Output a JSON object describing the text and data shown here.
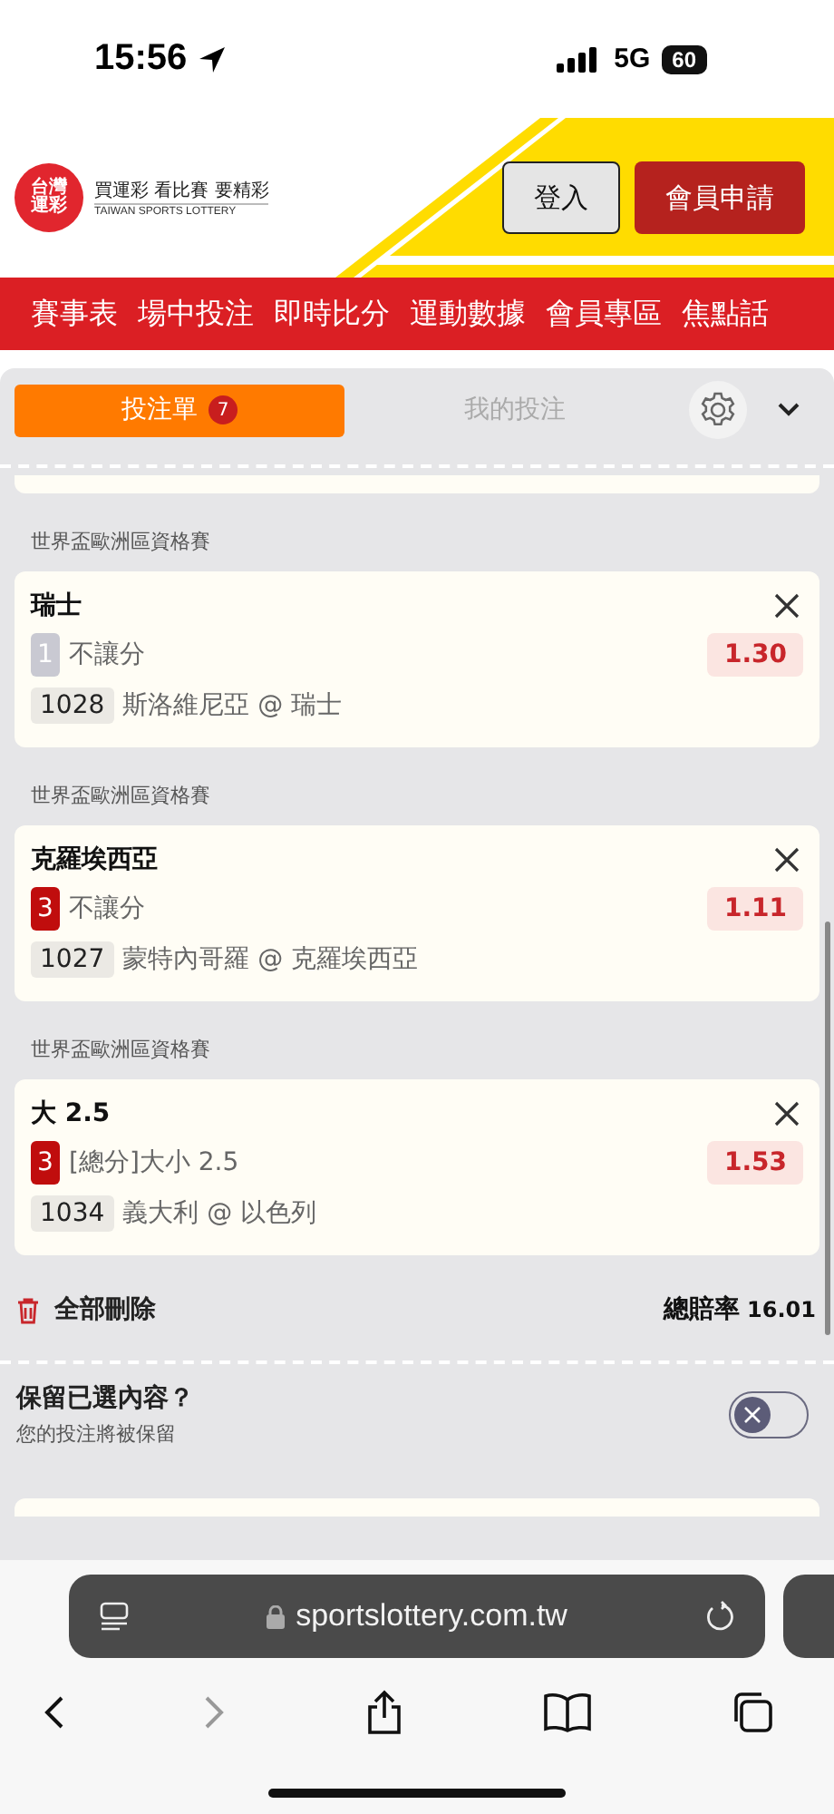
{
  "status_bar": {
    "time": "15:56",
    "network": "5G",
    "battery": "60"
  },
  "header": {
    "logo_text": "台灣運彩",
    "tagline": "買運彩 看比賽 要精彩",
    "logo_subtitle": "TAIWAN SPORTS LOTTERY",
    "buttons": [
      {
        "label": "登入",
        "kind": "secondary"
      },
      {
        "label": "會員申請",
        "kind": "primary"
      }
    ]
  },
  "nav": {
    "items": [
      "賽事表",
      "場中投注",
      "即時比分",
      "運動數據",
      "會員專區",
      "焦點話"
    ]
  },
  "bet_slip": {
    "tabs": [
      {
        "label": "投注單",
        "badge": "7",
        "selected": true
      },
      {
        "label": "我的投注",
        "selected": false
      }
    ],
    "bets": [
      {
        "league": "世界盃歐洲區資格賽",
        "title": "瑞士",
        "selection": "1",
        "selection_active": false,
        "market": "不讓分",
        "odds": "1.30",
        "code": "1028",
        "match": "斯洛維尼亞 @ 瑞士"
      },
      {
        "league": "世界盃歐洲區資格賽",
        "title": "克羅埃西亞",
        "selection": "3",
        "selection_active": true,
        "market": "不讓分",
        "odds": "1.11",
        "code": "1027",
        "match": "蒙特內哥羅 @ 克羅埃西亞"
      },
      {
        "league": "世界盃歐洲區資格賽",
        "title": "大 2.5",
        "selection": "3",
        "selection_active": true,
        "market": "[總分]大小 2.5",
        "odds": "1.53",
        "code": "1034",
        "match": "義大利 @ 以色列"
      }
    ],
    "delete_all": "全部刪除",
    "total_odds_label": "總賠率",
    "total_odds": "16.01",
    "keep": {
      "title": "保留已選內容？",
      "subtitle": "您的投注將被保留",
      "on": false
    }
  },
  "browser": {
    "url": "sportslottery.com.tw",
    "forward_disabled": true
  }
}
